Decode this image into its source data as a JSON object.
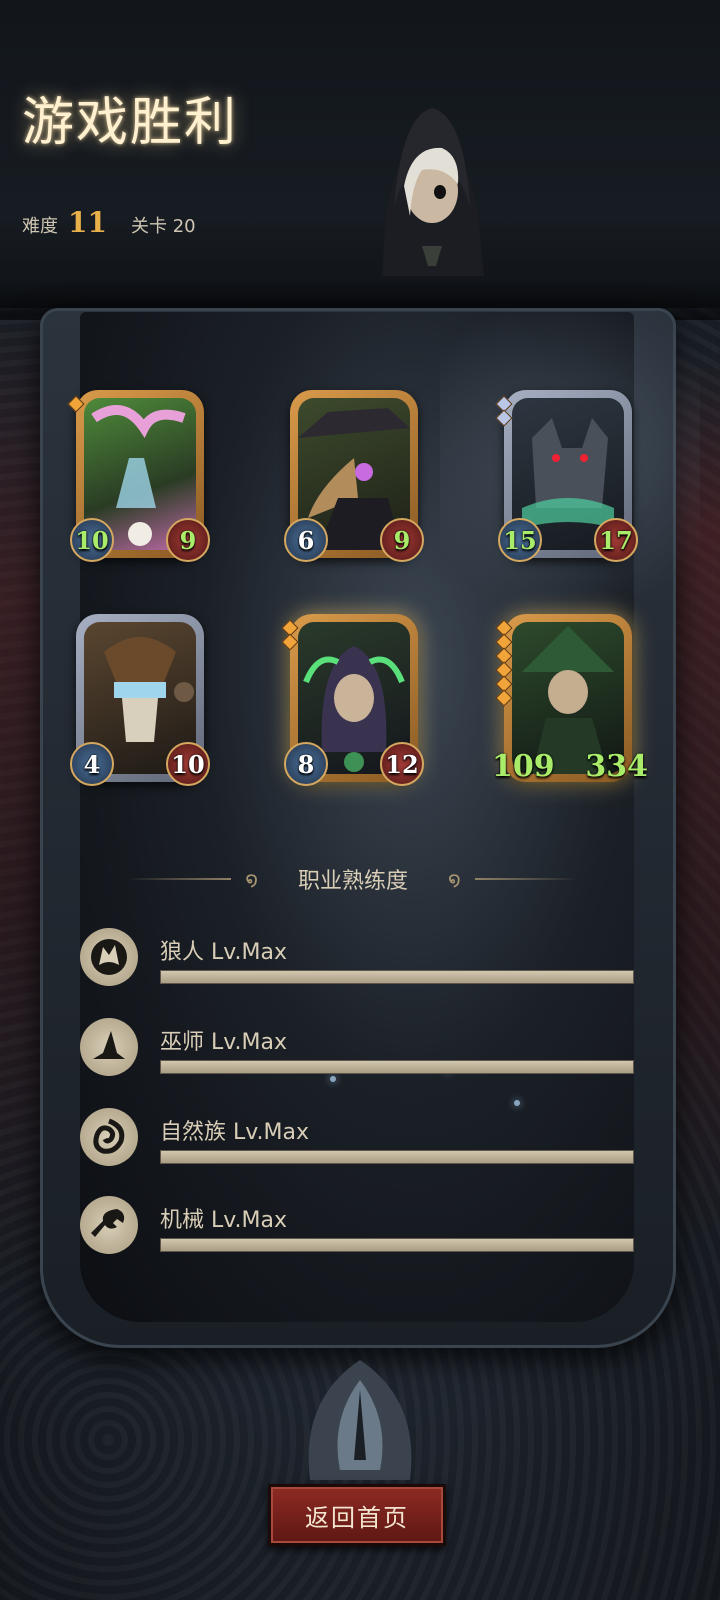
{
  "header": {
    "title": "游戏胜利",
    "difficulty_label": "难度",
    "difficulty_value": "11",
    "stage_label": "关卡 20"
  },
  "cards": [
    {
      "name": "plant-alchemist",
      "attack": "10",
      "health": "9",
      "attack_buffed": true,
      "health_buffed": true,
      "frame": "gold",
      "gems": 1
    },
    {
      "name": "plague-doctor",
      "attack": "6",
      "health": "9",
      "attack_buffed": false,
      "health_buffed": true,
      "frame": "gold",
      "gems": 0
    },
    {
      "name": "werewolf",
      "attack": "15",
      "health": "17",
      "attack_buffed": true,
      "health_buffed": true,
      "frame": "silver",
      "gems": 2
    },
    {
      "name": "mechanic-viking",
      "attack": "4",
      "health": "10",
      "attack_buffed": false,
      "health_buffed": false,
      "frame": "silver",
      "gems": 0
    },
    {
      "name": "hooded-sorcerer",
      "attack": "8",
      "health": "12",
      "attack_buffed": false,
      "health_buffed": false,
      "frame": "gold",
      "gems": 2
    },
    {
      "name": "green-witch",
      "attack": "109",
      "health": "334",
      "attack_buffed": true,
      "health_buffed": true,
      "frame": "gold",
      "gems": 6
    }
  ],
  "mastery": {
    "title": "职业熟练度",
    "classes": [
      {
        "label": "狼人 Lv.Max",
        "icon": "wolf-icon",
        "progress": 1.0
      },
      {
        "label": "巫师 Lv.Max",
        "icon": "wizard-hat-icon",
        "progress": 1.0
      },
      {
        "label": "自然族 Lv.Max",
        "icon": "nature-icon",
        "progress": 1.0
      },
      {
        "label": "机械 Lv.Max",
        "icon": "wrench-icon",
        "progress": 1.0
      }
    ]
  },
  "return_button": "返回首页",
  "colors": {
    "title_glow": "#fff0cf",
    "difficulty": "#e8b04a",
    "buffed_stat": "#a8ec6a",
    "button": "#8e2a24"
  }
}
